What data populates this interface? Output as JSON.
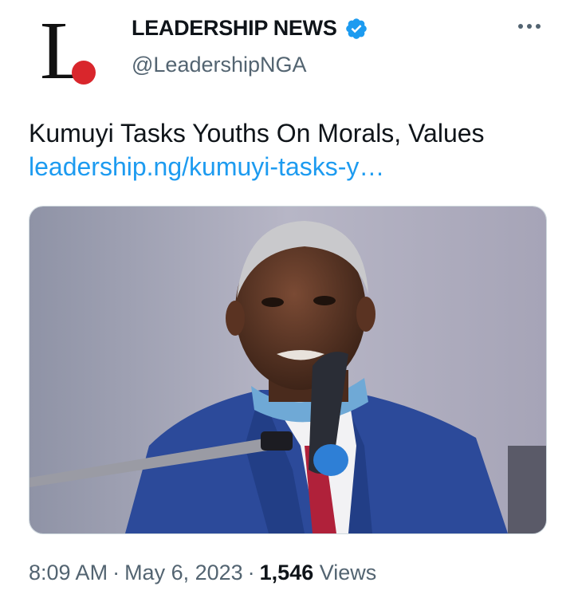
{
  "account": {
    "display_name": "LEADERSHIP NEWS",
    "handle": "@LeadershipNGA",
    "avatar_letter": "L",
    "verified": true,
    "brand_color": "#d9262c",
    "verified_color": "#1d9bf0"
  },
  "menu": {
    "icon": "more-horizontal-icon"
  },
  "tweet": {
    "text": "Kumuyi Tasks Youths On Morals, Values ",
    "link": "leadership.ng/kumuyi-tasks-y…",
    "link_color": "#1d9bf0"
  },
  "media": {
    "description_icon": "photo-of-elderly-man-speaking-into-microphone"
  },
  "meta": {
    "time": "8:09 AM",
    "date": "May 6, 2023",
    "separator": "·",
    "views_count": "1,546",
    "views_label": "Views"
  }
}
